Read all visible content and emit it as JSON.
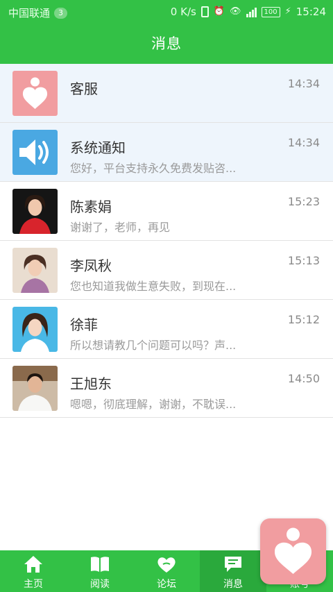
{
  "status_bar": {
    "carrier": "中国联通",
    "carrier_badge": "3",
    "net_speed": "0 K/s",
    "battery": "100",
    "time": "15:24"
  },
  "header": {
    "title": "消息"
  },
  "conversations": [
    {
      "name": "客服",
      "preview": "",
      "time": "14:34",
      "avatar": "heart-logo"
    },
    {
      "name": "系统通知",
      "preview": "您好，平台支持永久免费发贴咨...",
      "time": "14:34",
      "avatar": "speaker-icon"
    },
    {
      "name": "陈素娟",
      "preview": "谢谢了，老师，再见",
      "time": "15:23",
      "avatar": "photo"
    },
    {
      "name": "李凤秋",
      "preview": "您也知道我做生意失败，到现在...",
      "time": "15:13",
      "avatar": "photo"
    },
    {
      "name": "徐菲",
      "preview": "所以想请教几个问题可以吗？声...",
      "time": "15:12",
      "avatar": "photo"
    },
    {
      "name": "王旭东",
      "preview": "嗯嗯，彻底理解，谢谢，不耽误...",
      "time": "14:50",
      "avatar": "photo"
    }
  ],
  "tabs": [
    {
      "label": "主页",
      "icon": "home-icon"
    },
    {
      "label": "阅读",
      "icon": "book-icon"
    },
    {
      "label": "论坛",
      "icon": "forum-heart-icon"
    },
    {
      "label": "消息",
      "icon": "message-icon",
      "active": true
    },
    {
      "label": "账号",
      "icon": "account-icon"
    }
  ],
  "colors": {
    "brand_green": "#33c146",
    "active_tab_green": "#2aa93c",
    "logo_pink": "#f19da0",
    "pinned_row_bg": "#eef5fc",
    "speaker_blue": "#4aa8e2"
  }
}
